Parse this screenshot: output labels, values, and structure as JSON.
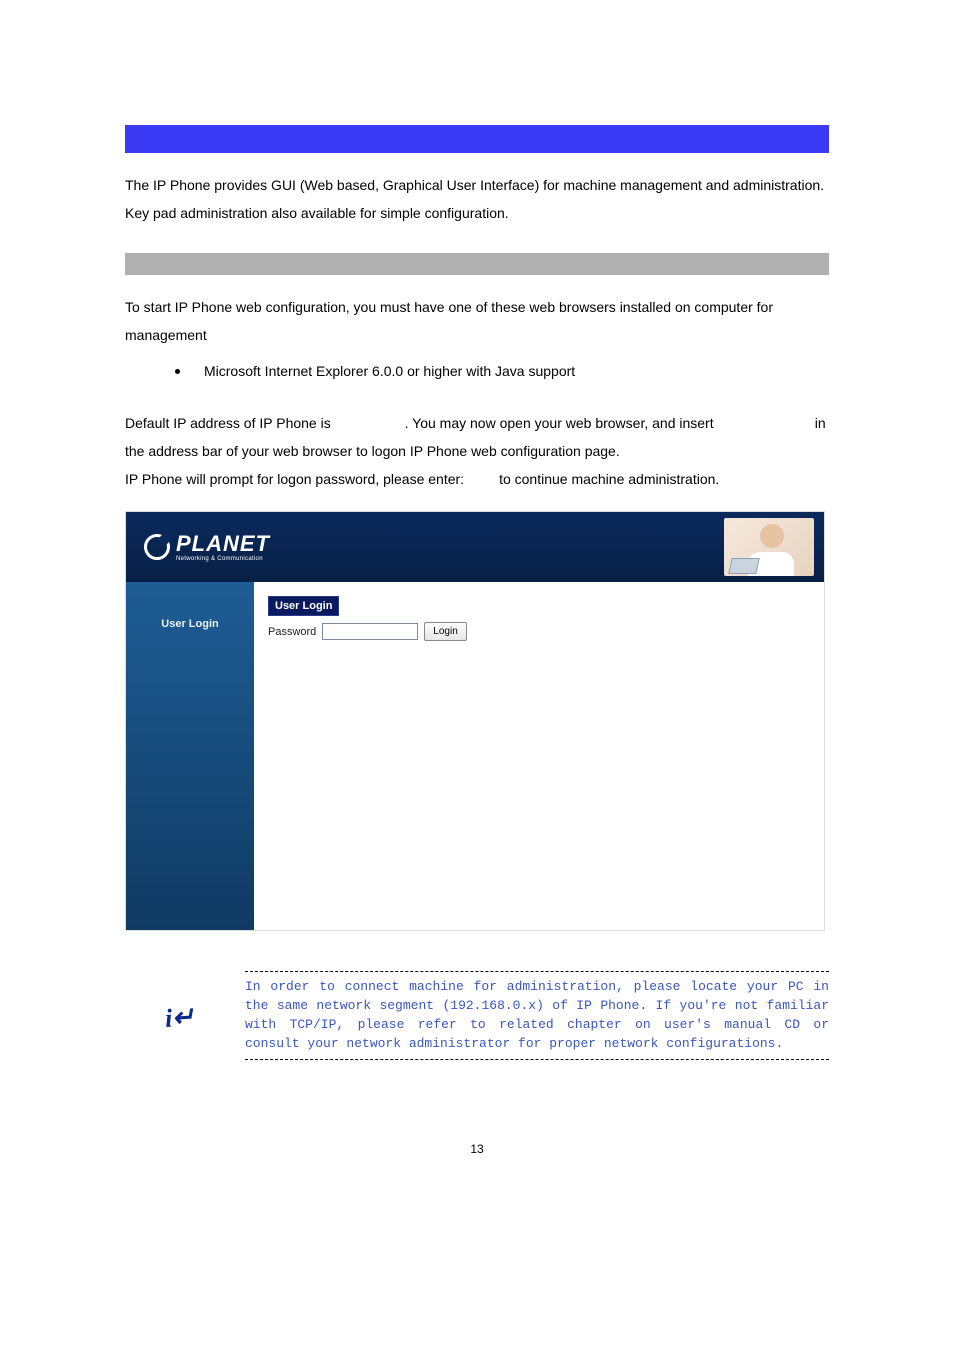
{
  "intro": "The IP Phone provides GUI (Web based, Graphical User Interface) for machine management and administration. Key pad administration also available for simple configuration.",
  "webReqIntro": "To start IP Phone web configuration, you must have one of these web browsers installed on computer for management",
  "browserReq": "Microsoft Internet Explorer 6.0.0 or higher with Java support",
  "defaultIp": {
    "line1_prefix": "Default IP address of IP Phone is ",
    "line1_suffix": ". You may now open your web browser, and insert ",
    "line2_suffix": " in the address bar of your web browser to logon IP Phone web configuration page.",
    "line3_prefix": "IP Phone will prompt for logon password, please enter: ",
    "line3_suffix": " to continue machine administration."
  },
  "screenshot": {
    "brand": "PLANET",
    "brandSub": "Networking & Communication",
    "sidebarItem": "User Login",
    "paneTitle": "User Login",
    "passwordLabel": "Password",
    "passwordValue": "",
    "loginButton": "Login"
  },
  "note": "In order to connect machine for administration, please locate your PC in the same network segment (192.168.0.x) of IP Phone. If you're not familiar with TCP/IP, please refer to related chapter on user's manual CD or consult your network administrator for proper network configurations.",
  "pageNumber": "13"
}
